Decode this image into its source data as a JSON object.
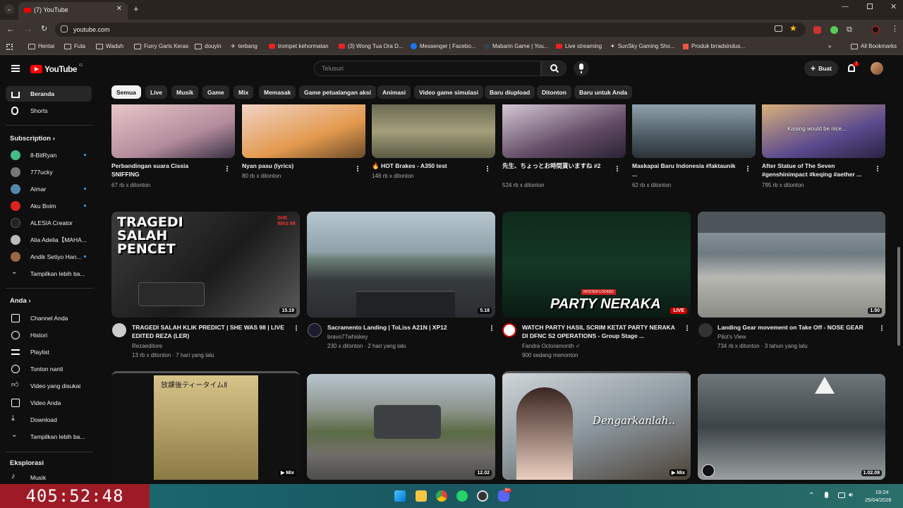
{
  "browser": {
    "tab_title": "(7) YouTube",
    "url": "youtube.com",
    "bookmarks": [
      "Hentai",
      "Futa",
      "Waduh",
      "Furry Garis Keras",
      "douyin",
      "terbang",
      "trompet kehormatan",
      "(3) Wong Tua Ora D...",
      "Messenger | Facebo...",
      "Mabarin Game | You...",
      "Live streaming",
      "SunSky Gaming Sho...",
      "Produk brradsindus..."
    ],
    "all_bookmarks": "All Bookmarks"
  },
  "youtube": {
    "logo": "YouTube",
    "logo_country": "ID",
    "search_placeholder": "Telusuri",
    "create_label": "Buat",
    "notif_count": "7"
  },
  "chips": [
    "Semua",
    "Live",
    "Musik",
    "Game",
    "Mix",
    "Memasak",
    "Game petualangan aksi",
    "Animasi",
    "Video game simulasi",
    "Baru diupload",
    "Ditonton",
    "Baru untuk Anda"
  ],
  "sidebar": {
    "home": "Beranda",
    "shorts": "Shorts",
    "subscription_header": "Subscription",
    "subscriptions": [
      "8-BitRyan",
      "777ucky",
      "Aimar",
      "Aku Boim",
      "ALESIA Creator",
      "Alia Adelia【MAHA...",
      "Andik Setiyo Han..."
    ],
    "show_more_subs": "Tampilkan lebih ba...",
    "you_header": "Anda",
    "you_items": [
      "Channel Anda",
      "Histori",
      "Playlist",
      "Tonton nanti",
      "Video yang disukai",
      "Video Anda",
      "Download"
    ],
    "show_more_you": "Tampilkan lebih ba...",
    "explore_header": "Eksplorasi",
    "explore_items": [
      "Musik"
    ]
  },
  "row1": [
    {
      "title": "Perbandingan suara Cissia SNIFFING",
      "views": "67 rb x ditonton"
    },
    {
      "title": "Nyan pasu (lyrics)",
      "views": "80 rb x ditonton"
    },
    {
      "title": "🔥 HOT Brakes - A350 test",
      "views": "148 rb x ditonton"
    },
    {
      "title": "先生、ちょっとお時間貰いますね #2",
      "views": "524 rb x ditonton"
    },
    {
      "title": "Maskapai Baru Indonesia #faktaunik ...",
      "views": "62 rb x ditonton"
    },
    {
      "title": "After Statue of The Seven #genshinimpact #keqing #aether ...",
      "views": "795 rb x ditonton",
      "overlay": "Kissing would be nice..."
    }
  ],
  "row2": [
    {
      "title": "TRAGEDI SALAH KLIK PREDICT | SHE WAS 98 | LIVE EDITED REZA (LER)",
      "channel": "Rezaeditore",
      "meta": "13 rb x ditonton · 7 hari yang lalu",
      "duration": "15.19",
      "thumb_text": "TRAGEDI SALAH PENCET",
      "thumb_text2": "SHE WAS 98"
    },
    {
      "title": "Sacramento Landing | ToLiss A21N | XP12",
      "channel": "bravo77whiskey",
      "meta": "230 x ditonton · 2 hari yang lalu",
      "duration": "5.18"
    },
    {
      "title": "WATCH PARTY HASIL SCRIM KETAT PARTY NERAKA DI DFNC S2 OPERATIONS - Group Stage ...",
      "channel": "Fandra Octoramonth",
      "meta": "900 sedang menonton",
      "live": "LIVE",
      "thumb_text": "PARTY NERAKA",
      "thumb_text2": "ROSTER LOCKED"
    },
    {
      "title": "Landing Gear movement on Take Off - NOSE GEAR",
      "channel": "Pilot's View",
      "meta": "734 rb x ditonton · 3 tahun yang lalu",
      "duration": "1.50"
    }
  ],
  "row3": [
    {
      "badge": "Mix",
      "thumb_text": "放課後ティータイムⅡ"
    },
    {
      "duration": "12.02"
    },
    {
      "badge": "Mix",
      "thumb_text": "Dengarkanlah.."
    },
    {
      "duration": "1.02.09"
    }
  ],
  "taskbar": {
    "timer": "405:52:48",
    "time": "19:24",
    "date": "25/04/2026",
    "discord_badge": "9+"
  }
}
